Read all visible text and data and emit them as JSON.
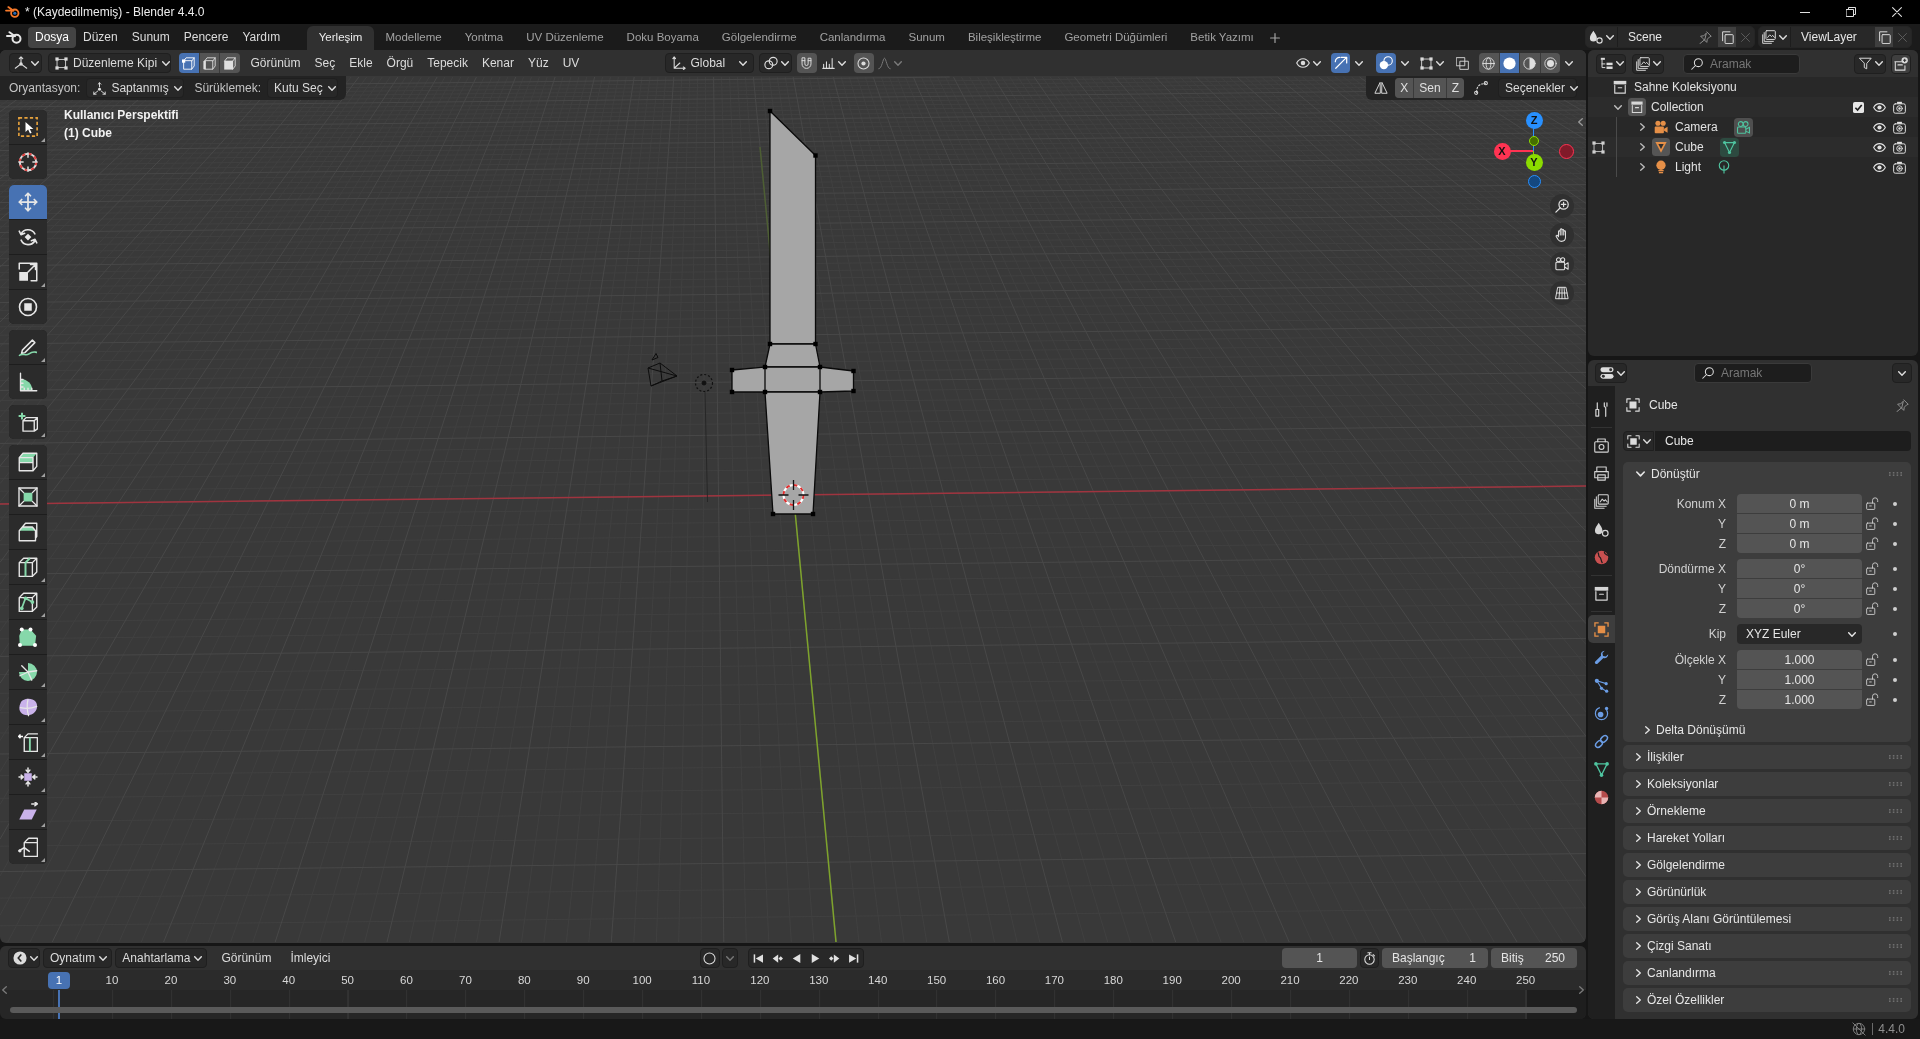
{
  "window": {
    "title": "* (Kaydedilmemiş) - Blender 4.4.0"
  },
  "top_bar": {
    "menus": [
      {
        "label": "Dosya",
        "highlighted": true
      },
      {
        "label": "Düzen",
        "highlighted": false
      },
      {
        "label": "Sunum",
        "highlighted": false
      },
      {
        "label": "Pencere",
        "highlighted": false
      },
      {
        "label": "Yardım",
        "highlighted": false
      }
    ],
    "workspaces": [
      {
        "label": "Yerleşim",
        "selected": true
      },
      {
        "label": "Modelleme",
        "selected": false
      },
      {
        "label": "Yontma",
        "selected": false
      },
      {
        "label": "UV Düzenleme",
        "selected": false
      },
      {
        "label": "Doku Boyama",
        "selected": false
      },
      {
        "label": "Gölgelendirme",
        "selected": false
      },
      {
        "label": "Canlandırma",
        "selected": false
      },
      {
        "label": "Sunum",
        "selected": false
      },
      {
        "label": "Bileşikleştirme",
        "selected": false
      },
      {
        "label": "Geometri Düğümleri",
        "selected": false
      },
      {
        "label": "Betik Yazımı",
        "selected": false
      }
    ],
    "scene": {
      "value": "Scene"
    },
    "view_layer": {
      "value": "ViewLayer"
    }
  },
  "viewport": {
    "header": {
      "mode": "Düzenleme Kipi",
      "select_modes": [
        {
          "kind": "vertex",
          "selected": true
        },
        {
          "kind": "edge",
          "selected": false
        },
        {
          "kind": "face",
          "selected": false
        }
      ],
      "menus": [
        "Görünüm",
        "Seç",
        "Ekle",
        "Örgü",
        "Tepecik",
        "Kenar",
        "Yüz",
        "UV"
      ],
      "transform_orientation": "Global",
      "snap": {
        "on": false
      },
      "proportional_editing": {
        "on": false
      },
      "gizmos": {
        "on": true
      },
      "overlays": {
        "on": true
      },
      "xray": {
        "on": false
      },
      "shading": [
        {
          "kind": "wireframe",
          "selected": false
        },
        {
          "kind": "solid",
          "selected": true
        },
        {
          "kind": "material",
          "selected": false
        },
        {
          "kind": "rendered",
          "selected": false
        }
      ]
    },
    "tool_settings": {
      "orientation": {
        "label": "Oryantasyon:",
        "value": "Saptanmış"
      },
      "drag": {
        "label": "Sürüklemek:",
        "value": "Kutu Seç"
      },
      "mirror_axes": [
        {
          "label": "X",
          "selected": false
        },
        {
          "label": "Sen",
          "selected": false
        },
        {
          "label": "Z",
          "selected": false
        }
      ],
      "options": "Seçenekler"
    },
    "view_info": [
      "Kullanıcı Perspektifi",
      "(1) Cube"
    ],
    "toolbar": [
      {
        "tools": [
          {
            "kind": "select_box",
            "selected": false,
            "more": true
          },
          {
            "kind": "cursor",
            "selected": false,
            "more": false
          }
        ]
      },
      {
        "tools": [
          {
            "kind": "move",
            "selected": true,
            "more": false
          },
          {
            "kind": "rotate",
            "selected": false,
            "more": false
          },
          {
            "kind": "scale",
            "selected": false,
            "more": true
          },
          {
            "kind": "transform",
            "selected": false,
            "more": false
          }
        ]
      },
      {
        "tools": [
          {
            "kind": "annotate",
            "selected": false,
            "more": true
          },
          {
            "kind": "measure",
            "selected": false,
            "more": false
          }
        ]
      },
      {
        "tools": [
          {
            "kind": "add_cube",
            "selected": false,
            "more": true
          }
        ]
      },
      {
        "tools": [
          {
            "kind": "extrude",
            "selected": false,
            "more": true
          },
          {
            "kind": "inset",
            "selected": false,
            "more": false
          },
          {
            "kind": "bevel",
            "selected": false,
            "more": false
          },
          {
            "kind": "loop_cut",
            "selected": false,
            "more": true
          },
          {
            "kind": "knife",
            "selected": false,
            "more": true
          },
          {
            "kind": "poly_build",
            "selected": false,
            "more": false
          },
          {
            "kind": "spin",
            "selected": false,
            "more": true
          },
          {
            "kind": "smooth",
            "selected": false,
            "more": true
          },
          {
            "kind": "edge_slide",
            "selected": false,
            "more": true
          },
          {
            "kind": "shrink_fatten",
            "selected": false,
            "more": true
          },
          {
            "kind": "shear",
            "selected": false,
            "more": true
          },
          {
            "kind": "rip",
            "selected": false,
            "more": true
          }
        ]
      }
    ],
    "navigation_gizmo": {
      "axes": [
        {
          "label": "X",
          "color": "#ff3352"
        },
        {
          "label": "Y",
          "color": "#8bdc00"
        },
        {
          "label": "Z",
          "color": "#2890ff"
        }
      ]
    }
  },
  "outliner": {
    "search": {
      "placeholder": "Aramak"
    },
    "tree": [
      {
        "label": "Sahne Koleksiyonu",
        "kind": "scene_collection",
        "children": [
          {
            "label": "Collection",
            "kind": "collection",
            "expanded": true,
            "active": true,
            "included": true,
            "visible": true,
            "renderable": true,
            "children": [
              {
                "label": "Camera",
                "kind": "camera",
                "expanded": false,
                "active": false,
                "edit_mode": false,
                "data_highlighted": true,
                "visible": true,
                "renderable": true
              },
              {
                "label": "Cube",
                "kind": "mesh",
                "expanded": false,
                "active": true,
                "edit_mode": true,
                "data_highlighted": true,
                "visible": true,
                "renderable": true
              },
              {
                "label": "Light",
                "kind": "light",
                "expanded": false,
                "active": false,
                "edit_mode": false,
                "data_highlighted": false,
                "visible": true,
                "renderable": true
              }
            ]
          }
        ]
      }
    ]
  },
  "properties": {
    "search": {
      "placeholder": "Aramak"
    },
    "tabs": [
      {
        "kind": "tool",
        "selected": false
      },
      {
        "kind": "render",
        "selected": false
      },
      {
        "kind": "output",
        "selected": false
      },
      {
        "kind": "view_layer",
        "selected": false
      },
      {
        "kind": "scene",
        "selected": false
      },
      {
        "kind": "world",
        "selected": false
      },
      {
        "kind": "collection",
        "selected": false
      },
      {
        "kind": "object",
        "selected": true
      },
      {
        "kind": "modifiers",
        "selected": false
      },
      {
        "kind": "particles",
        "selected": false
      },
      {
        "kind": "physics",
        "selected": false
      },
      {
        "kind": "constraints",
        "selected": false
      },
      {
        "kind": "data",
        "selected": false
      },
      {
        "kind": "material",
        "selected": false
      }
    ],
    "context": "Cube",
    "object_name": "Cube",
    "panels": [
      {
        "title": "Dönüştür",
        "expanded": true,
        "groups": [
          {
            "rows": [
              {
                "label": "Konum X",
                "value": "0 m",
                "kind": "number",
                "locked": false
              },
              {
                "label": "Y",
                "value": "0 m",
                "kind": "number",
                "locked": false
              },
              {
                "label": "Z",
                "value": "0 m",
                "kind": "number",
                "locked": false
              }
            ]
          },
          {
            "rows": [
              {
                "label": "Döndürme X",
                "value": "0°",
                "kind": "number",
                "locked": false
              },
              {
                "label": "Y",
                "value": "0°",
                "kind": "number",
                "locked": false
              },
              {
                "label": "Z",
                "value": "0°",
                "kind": "number",
                "locked": false
              }
            ]
          },
          {
            "rows": [
              {
                "label": "Kip",
                "value": "XYZ Euler",
                "kind": "dropdown"
              }
            ]
          },
          {
            "rows": [
              {
                "label": "Ölçekle X",
                "value": "1.000",
                "kind": "number",
                "locked": false
              },
              {
                "label": "Y",
                "value": "1.000",
                "kind": "number",
                "locked": false
              },
              {
                "label": "Z",
                "value": "1.000",
                "kind": "number",
                "locked": false
              }
            ]
          }
        ],
        "subpanels": [
          {
            "title": "Delta Dönüşümü",
            "expanded": false
          }
        ]
      },
      {
        "title": "İlişkiler",
        "expanded": false
      },
      {
        "title": "Koleksiyonlar",
        "expanded": false
      },
      {
        "title": "Örnekleme",
        "expanded": false
      },
      {
        "title": "Hareket Yolları",
        "expanded": false
      },
      {
        "title": "Gölgelendirme",
        "expanded": false
      },
      {
        "title": "Görünürlük",
        "expanded": false
      },
      {
        "title": "Görüş Alanı Görüntülemesi",
        "expanded": false
      },
      {
        "title": "Çizgi Sanatı",
        "expanded": false
      },
      {
        "title": "Canlandırma",
        "expanded": false
      },
      {
        "title": "Özel Özellikler",
        "expanded": false
      }
    ]
  },
  "timeline": {
    "menus": [
      {
        "label": "Oynatım",
        "kind": "dropdown"
      },
      {
        "label": "Anahtarlama",
        "kind": "dropdown"
      },
      {
        "label": "Görünüm",
        "kind": "menu"
      },
      {
        "label": "İmleyici",
        "kind": "menu"
      }
    ],
    "auto_keying": {
      "on": false
    },
    "current_frame": "1",
    "start": {
      "label": "Başlangıç",
      "value": "1"
    },
    "end": {
      "label": "Bitiş",
      "value": "250"
    },
    "playhead": "1",
    "ruler": [
      "10",
      "20",
      "30",
      "40",
      "50",
      "60",
      "70",
      "80",
      "90",
      "100",
      "110",
      "120",
      "130",
      "140",
      "150",
      "160",
      "170",
      "180",
      "190",
      "200",
      "210",
      "220",
      "230",
      "240",
      "250"
    ]
  },
  "status_bar": {
    "version": "4.4.0"
  }
}
